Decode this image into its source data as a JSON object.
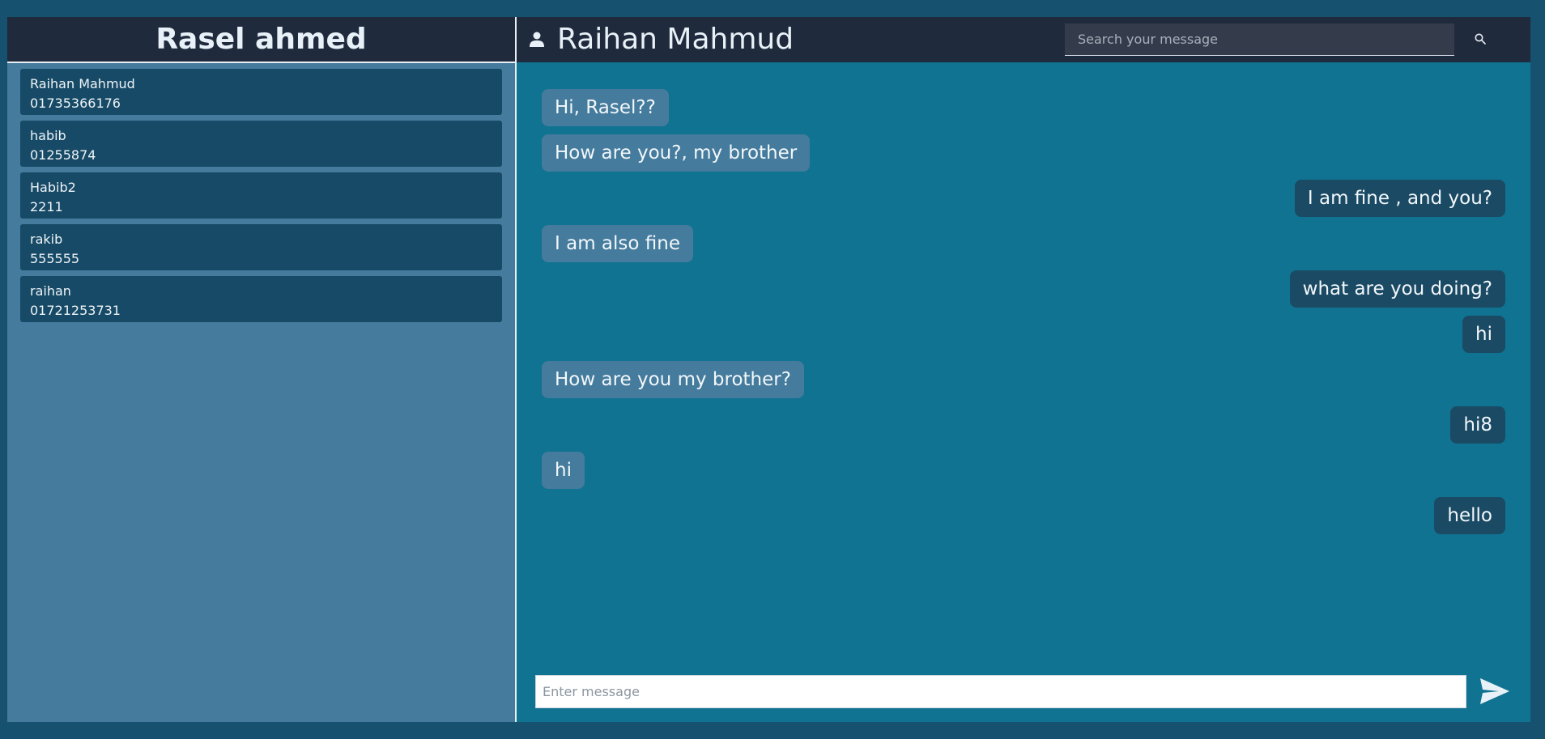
{
  "user": {
    "name": "Rasel ahmed"
  },
  "contacts": [
    {
      "name": "Raihan Mahmud",
      "phone": "01735366176"
    },
    {
      "name": "habib",
      "phone": "01255874"
    },
    {
      "name": "Habib2",
      "phone": "2211"
    },
    {
      "name": "rakib",
      "phone": "555555"
    },
    {
      "name": "raihan",
      "phone": "01721253731"
    }
  ],
  "chat": {
    "title": "Raihan Mahmud",
    "search_placeholder": "Search your message",
    "messages": [
      {
        "text": "Hi, Rasel??",
        "direction": "in"
      },
      {
        "text": "How are you?, my brother",
        "direction": "in"
      },
      {
        "text": "I am fine , and you?",
        "direction": "out"
      },
      {
        "text": "I am also fine",
        "direction": "in"
      },
      {
        "text": "what are you doing?",
        "direction": "out"
      },
      {
        "text": "hi",
        "direction": "out"
      },
      {
        "text": "How are you my brother?",
        "direction": "in"
      },
      {
        "text": "hi8",
        "direction": "out"
      },
      {
        "text": "hi",
        "direction": "in"
      },
      {
        "text": "hello",
        "direction": "out"
      }
    ],
    "input_placeholder": "Enter message"
  },
  "icons": {
    "person": "person-icon",
    "search": "search-icon",
    "send": "send-icon"
  },
  "colors": {
    "page_bg": "#175170",
    "sidebar_bg": "#457b9d",
    "header_bg": "#1f2a3d",
    "contact_bg": "#174a66",
    "chat_bg": "#107391",
    "incoming_bubble": "#457b9d",
    "outgoing_bubble": "#1a4a64"
  }
}
